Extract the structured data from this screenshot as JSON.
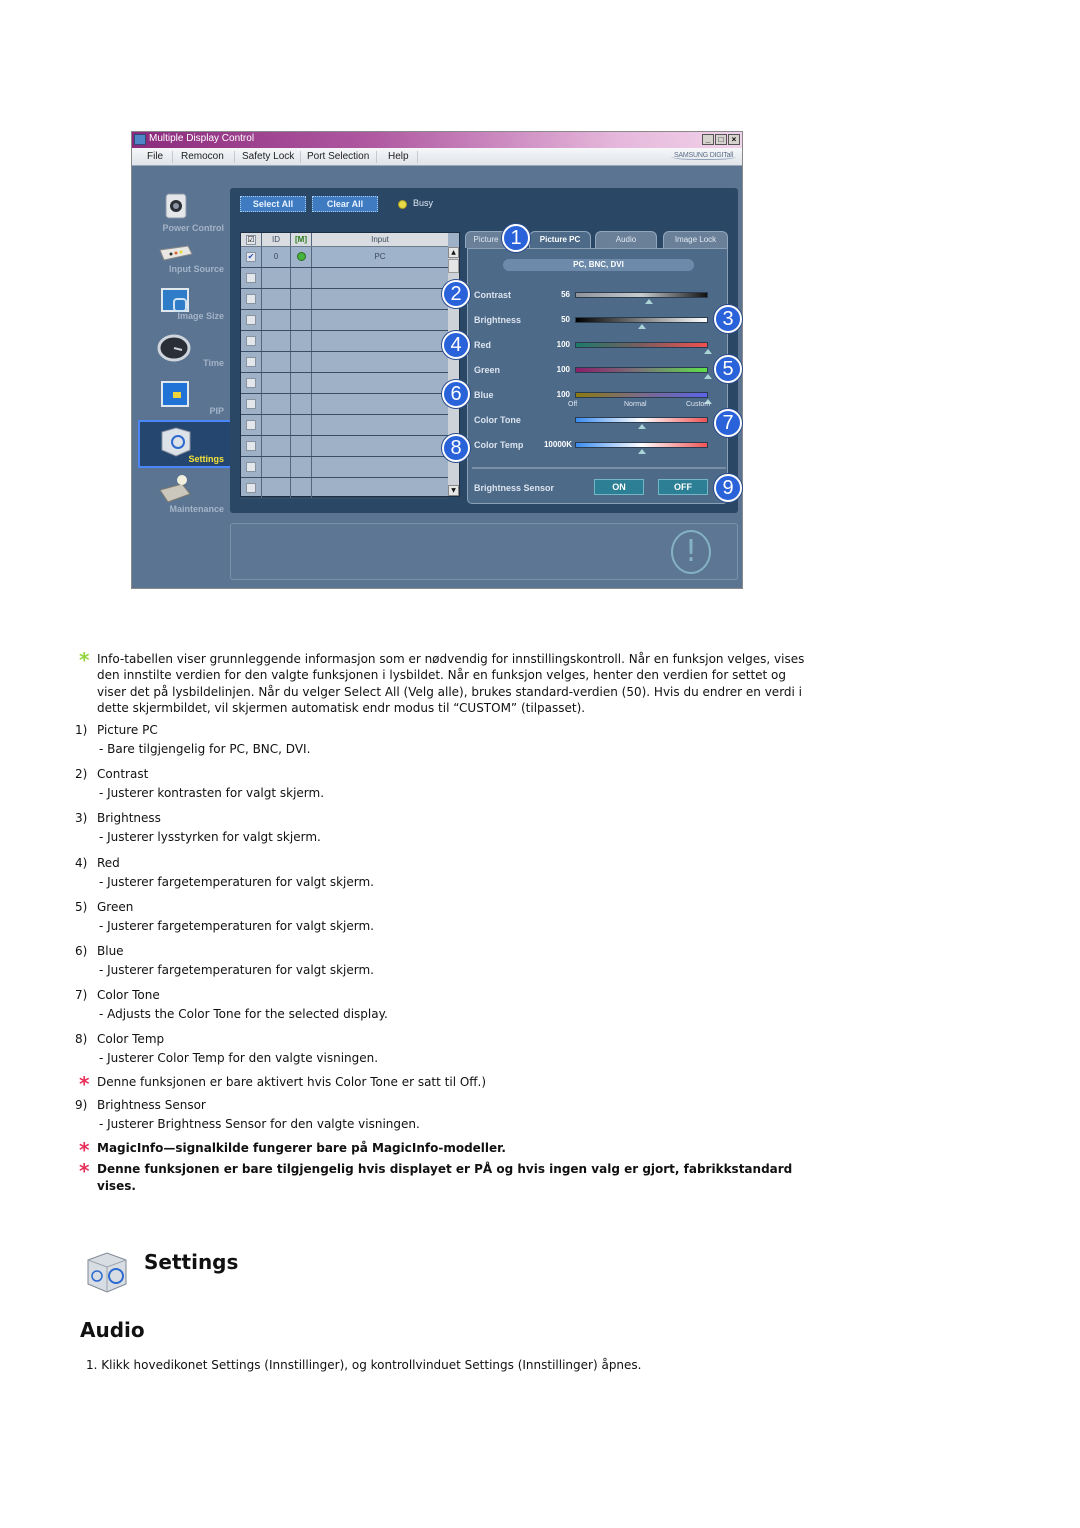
{
  "window": {
    "title": "Multiple Display Control",
    "controls": [
      "_",
      "□",
      "×"
    ],
    "menu": [
      "File",
      "Remocon",
      "Safety Lock",
      "Port Selection",
      "Help"
    ],
    "brand": "SAMSUNG DIGITall"
  },
  "sidebar": {
    "items": [
      {
        "label": "Power Control",
        "icon": "power-control-icon"
      },
      {
        "label": "Input Source",
        "icon": "input-source-icon"
      },
      {
        "label": "Image Size",
        "icon": "image-size-icon"
      },
      {
        "label": "Time",
        "icon": "clock-icon"
      },
      {
        "label": "PIP",
        "icon": "pip-icon"
      },
      {
        "label": "Settings",
        "icon": "settings-cube-icon",
        "active": true
      },
      {
        "label": "Maintenance",
        "icon": "maintenance-icon"
      }
    ]
  },
  "toolbar": {
    "select_all": "Select All",
    "clear_all": "Clear All",
    "busy_label": "Busy"
  },
  "grid": {
    "headers": {
      "check": "☑",
      "id": "ID",
      "status": "[M]",
      "input": "Input"
    },
    "rows": [
      {
        "checked": true,
        "id": "0",
        "status": "on",
        "input": "PC"
      },
      {
        "checked": false,
        "id": "",
        "status": "",
        "input": ""
      },
      {
        "checked": false,
        "id": "",
        "status": "",
        "input": ""
      },
      {
        "checked": false,
        "id": "",
        "status": "",
        "input": ""
      },
      {
        "checked": false,
        "id": "",
        "status": "",
        "input": ""
      },
      {
        "checked": false,
        "id": "",
        "status": "",
        "input": ""
      },
      {
        "checked": false,
        "id": "",
        "status": "",
        "input": ""
      },
      {
        "checked": false,
        "id": "",
        "status": "",
        "input": ""
      },
      {
        "checked": false,
        "id": "",
        "status": "",
        "input": ""
      },
      {
        "checked": false,
        "id": "",
        "status": "",
        "input": ""
      },
      {
        "checked": false,
        "id": "",
        "status": "",
        "input": ""
      },
      {
        "checked": false,
        "id": "",
        "status": "",
        "input": ""
      }
    ]
  },
  "tabs": [
    {
      "label": "Picture",
      "active": false
    },
    {
      "label": "Picture PC",
      "active": true
    },
    {
      "label": "Audio",
      "active": false
    },
    {
      "label": "Image Lock",
      "active": false
    }
  ],
  "settings": {
    "source_pill": "PC, BNC, DVI",
    "sliders": [
      {
        "label": "Contrast",
        "value": "56",
        "fraction": 0.56
      },
      {
        "label": "Brightness",
        "value": "50",
        "fraction": 0.5
      },
      {
        "label": "Red",
        "value": "100",
        "fraction": 1.0
      },
      {
        "label": "Green",
        "value": "100",
        "fraction": 1.0
      },
      {
        "label": "Blue",
        "value": "100",
        "fraction": 1.0
      }
    ],
    "color_tone": {
      "label": "Color Tone",
      "marks": [
        "Off",
        "Normal",
        "Custom"
      ],
      "fraction": 0.5
    },
    "color_temp": {
      "label": "Color Temp",
      "value": "10000K",
      "fraction": 0.5
    },
    "brightness_sensor": {
      "label": "Brightness Sensor",
      "on": "ON",
      "off": "OFF"
    }
  },
  "callouts": [
    "1",
    "2",
    "3",
    "4",
    "5",
    "6",
    "7",
    "8",
    "9"
  ],
  "doc": {
    "intro": "Info-tabellen viser grunnleggende informasjon som er nødvendig for innstillingskontroll. Når en funksjon velges, vises den innstilte verdien for den valgte funksjonen i lysbildet. Når en funksjon velges, henter den verdien for settet og viser det på lysbildelinjen. Når du velger Select All (Velg alle), brukes standard-verdien (50). Hvis du endrer en verdi i dette skjermbildet, vil skjermen automatisk endr modus til “CUSTOM” (tilpasset).",
    "items": [
      {
        "num": "1)",
        "title": "Picture PC",
        "desc": "- Bare tilgjengelig for PC, BNC, DVI."
      },
      {
        "num": "2)",
        "title": "Contrast",
        "desc": "- Justerer kontrasten for valgt skjerm."
      },
      {
        "num": "3)",
        "title": "Brightness",
        "desc": "- Justerer lysstyrken for valgt skjerm."
      },
      {
        "num": "4)",
        "title": "Red",
        "desc": "- Justerer fargetemperaturen for valgt skjerm."
      },
      {
        "num": "5)",
        "title": "Green",
        "desc": "- Justerer fargetemperaturen for valgt skjerm."
      },
      {
        "num": "6)",
        "title": "Blue",
        "desc": "- Justerer fargetemperaturen for valgt skjerm."
      },
      {
        "num": "7)",
        "title": "Color Tone",
        "desc": "- Adjusts the Color Tone for the selected display."
      },
      {
        "num": "8)",
        "title": "Color Temp",
        "desc": "- Justerer Color Temp for den valgte visningen."
      }
    ],
    "note_color_temp": "Denne funksjonen er bare aktivert hvis Color Tone er satt til Off.)",
    "item9": {
      "num": "9)",
      "title": "Brightness Sensor",
      "desc": "- Justerer Brightness Sensor for den valgte visningen."
    },
    "note_magicinfo": "MagicInfo—signalkilde fungerer bare på MagicInfo-modeller.",
    "note_default": "Denne funksjonen er bare tilgjengelig hvis displayet er PÅ og hvis ingen valg er gjort, fabrikkstandard vises.",
    "heading_settings": "Settings",
    "heading_audio": "Audio",
    "step1": "1.  Klikk hovedikonet Settings (Innstillinger), og kontrollvinduet Settings (Innstillinger) åpnes."
  },
  "colors": {
    "star_green": "#93d43b",
    "star_red": "#e8305a",
    "callout_blue": "#2962d9",
    "active_border": "#4b86ff"
  }
}
